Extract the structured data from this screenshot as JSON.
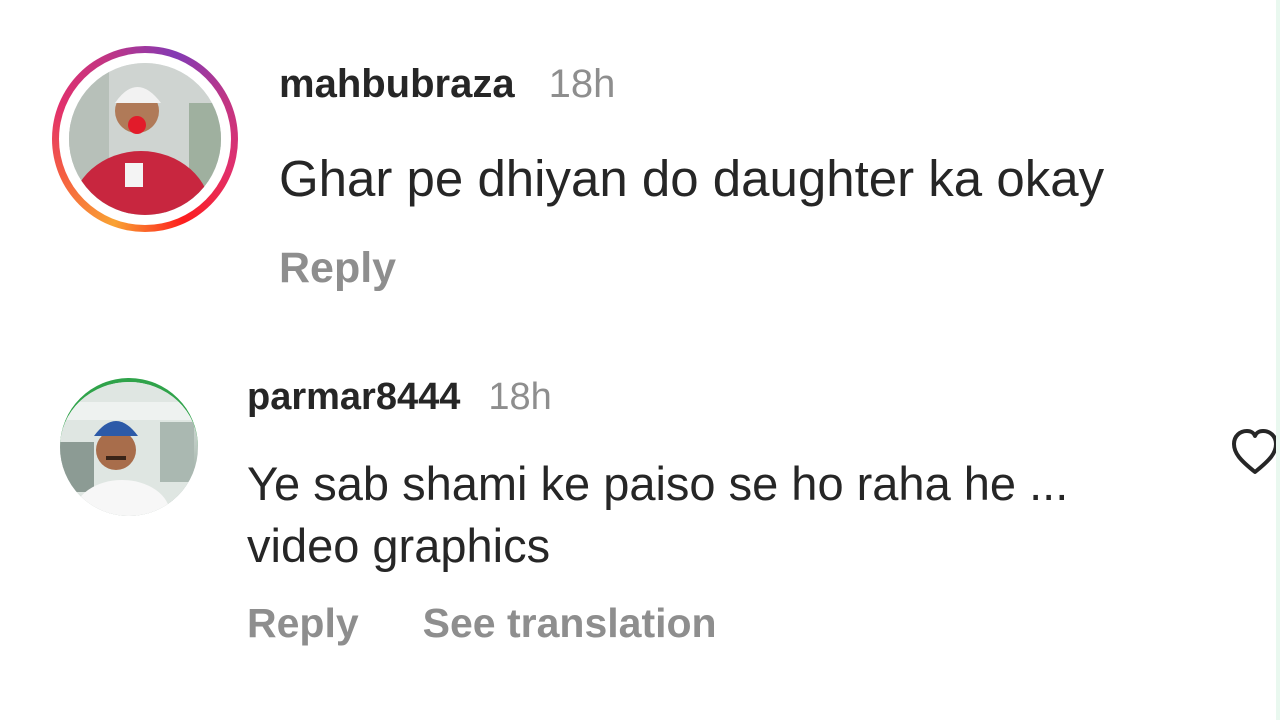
{
  "comments": [
    {
      "username": "mahbubraza",
      "time": "18h",
      "text": "Ghar pe dhiyan do daughter ka okay",
      "reply_label": "Reply",
      "has_story_ring": true
    },
    {
      "username": "parmar8444",
      "time": "18h",
      "text_line1": "Ye sab shami ke paiso se ho raha he ...",
      "text_line2": "video graphics",
      "reply_label": "Reply",
      "translate_label": "See translation",
      "has_story_ring": false
    }
  ],
  "icons": {
    "like": "heart-outline-icon"
  },
  "colors": {
    "text_primary": "#262626",
    "text_secondary": "#8e8e8e",
    "story_ring_start": "#f9a233",
    "story_ring_end": "#c13584"
  }
}
